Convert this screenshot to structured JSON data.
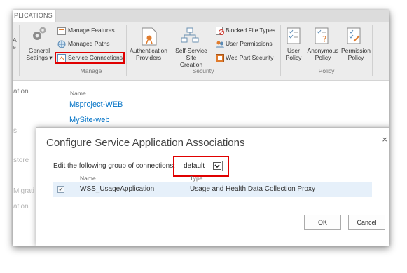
{
  "ribbon": {
    "tab_label": "PLICATIONS",
    "left_fragments": [
      "A",
      "e"
    ],
    "general_settings": {
      "line1": "General",
      "line2": "Settings ▾"
    },
    "manage": {
      "items": [
        "Manage Features",
        "Managed Paths",
        "Service Connections"
      ],
      "group_label": "Manage"
    },
    "security": {
      "auth": {
        "line1": "Authentication",
        "line2": "Providers"
      },
      "selfservice": {
        "line1": "Self-Service Site",
        "line2": "Creation"
      },
      "items": [
        "Blocked File Types",
        "User Permissions",
        "Web Part Security"
      ],
      "group_label": "Security"
    },
    "policy": {
      "user": {
        "line1": "User",
        "line2": "Policy"
      },
      "anon": {
        "line1": "Anonymous",
        "line2": "Policy"
      },
      "perm": {
        "line1": "Permission",
        "line2": "Policy"
      },
      "group_label": "Policy"
    }
  },
  "page": {
    "left_nav": [
      "ation",
      "s",
      "store",
      "Migrati",
      "ation"
    ],
    "name_header": "Name",
    "sites": [
      "Msproject-WEB",
      "MySite-web"
    ]
  },
  "dialog": {
    "title": "Configure Service Application Associations",
    "close_glyph": "×",
    "edit_label": "Edit the following group of connections:",
    "group_select": {
      "value": "default",
      "arrow": "▼"
    },
    "columns": {
      "name": "Name",
      "type": "Type"
    },
    "rows": [
      {
        "checkmark": "✓",
        "name": "WSS_UsageApplication",
        "type": "Usage and Health Data Collection Proxy"
      }
    ],
    "ok_label": "OK",
    "cancel_label": "Cancel"
  },
  "colors": {
    "highlight": "#e00000",
    "link": "#0072c6",
    "row_bg": "#e6f0fa"
  }
}
